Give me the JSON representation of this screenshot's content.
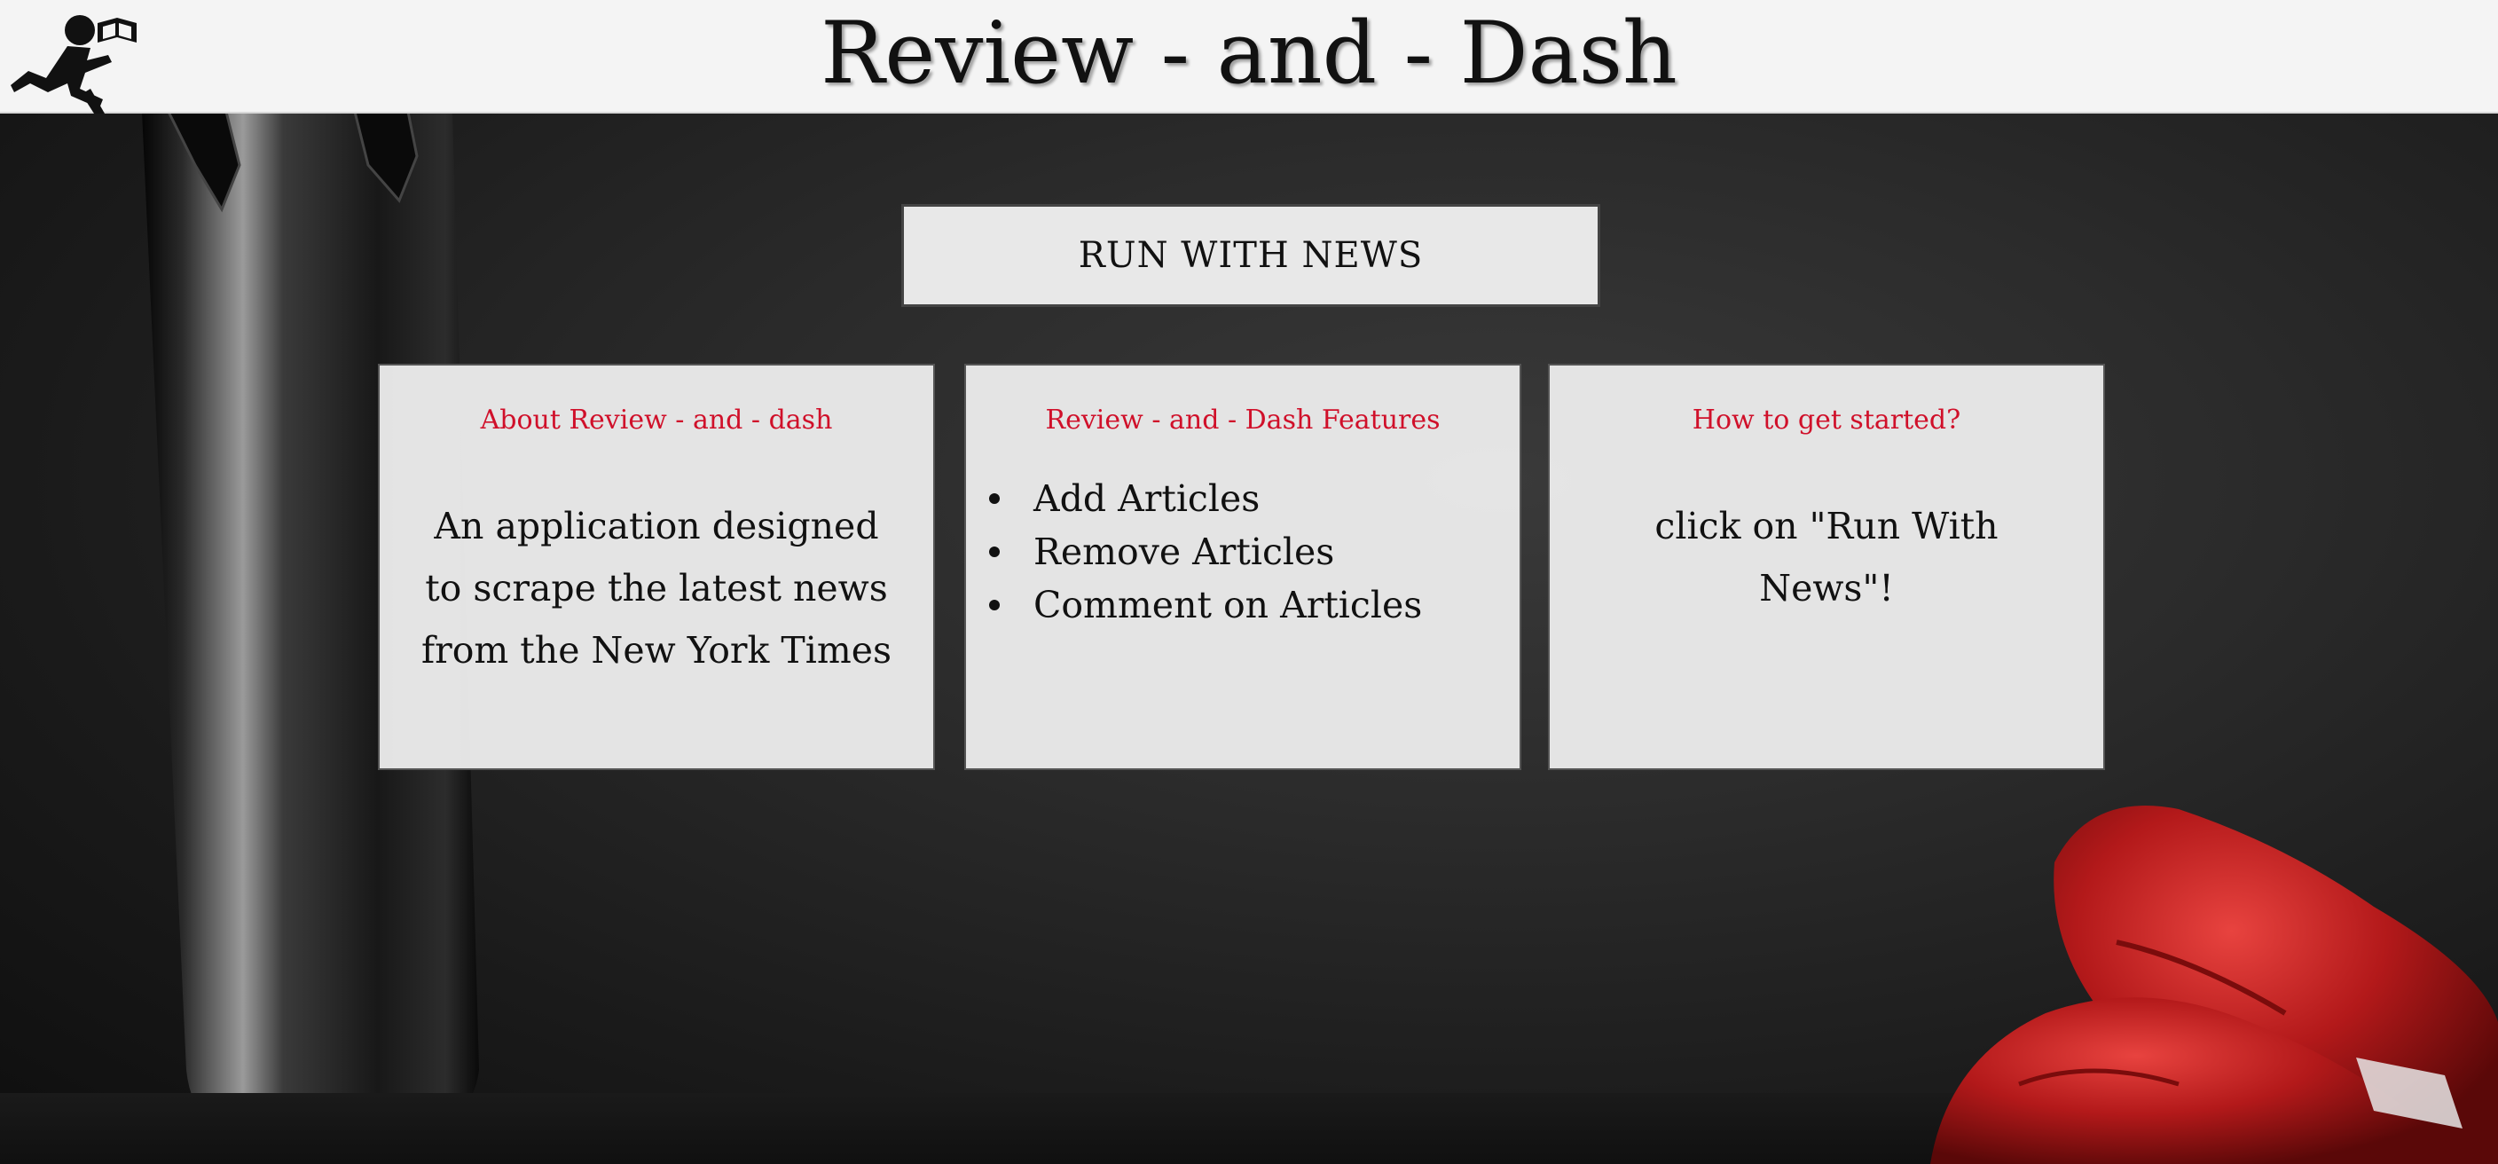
{
  "header": {
    "title": "Review - and - Dash",
    "logo_icon": "runner-with-book-icon"
  },
  "hero": {
    "run_button_label": "RUN WITH NEWS"
  },
  "cards": [
    {
      "title": "About Review - and - dash",
      "body": "An application designed to scrape the latest news from the New York Times"
    },
    {
      "title": "Review - and - Dash Features",
      "features": [
        "Add Articles",
        "Remove Articles",
        "Comment on Articles"
      ]
    },
    {
      "title": "How to get started?",
      "body": "click on \"Run With News\"!"
    }
  ],
  "colors": {
    "header_bg": "#f4f4f4",
    "card_title": "#d0102a",
    "card_bg": "#eaeaea",
    "page_bg": "#1c1c1c"
  }
}
